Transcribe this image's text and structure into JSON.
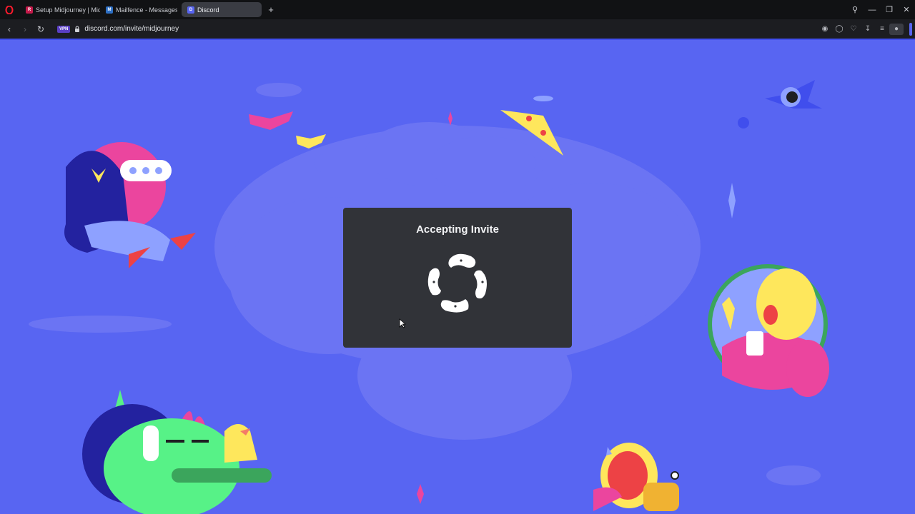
{
  "browser": {
    "tabs": [
      {
        "label": "Setup Midjourney | Midjo",
        "favicon": "rpi-icon",
        "active": false
      },
      {
        "label": "Mailfence - Messages",
        "favicon": "mailfence-icon",
        "active": false
      },
      {
        "label": "Discord",
        "favicon": "discord-icon",
        "active": true
      }
    ],
    "vpn_badge": "VPN",
    "url": "discord.com/invite/midjourney",
    "accent_color": "#5865f2"
  },
  "page": {
    "background_color": "#5865f2",
    "modal": {
      "title": "Accepting Invite",
      "spinner": "hands-spinner-icon"
    }
  }
}
